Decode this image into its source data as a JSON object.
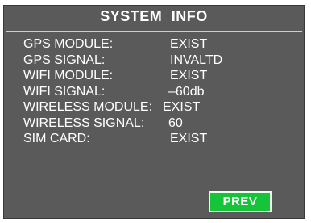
{
  "title": "SYSTEM  INFO",
  "rows": [
    {
      "label": "GPS MODULE:",
      "value": "EXIST"
    },
    {
      "label": "GPS SIGNAL:",
      "value": "INVALTD"
    },
    {
      "label": "WIFI MODULE:",
      "value": "EXIST"
    },
    {
      "label": "WIFI  SIGNAL:",
      "value": "–60db"
    },
    {
      "label": "WIRELESS MODULE:",
      "value": "EXIST"
    },
    {
      "label": "WIRELESS SIGNAL:",
      "value": "60"
    },
    {
      "label": "SIM CARD:",
      "value": "EXIST"
    }
  ],
  "buttons": {
    "prev_label": "PREV"
  },
  "colors": {
    "panel_bg": "#5a5a5a",
    "button_bg": "#16c43a",
    "text": "#ffffff"
  }
}
